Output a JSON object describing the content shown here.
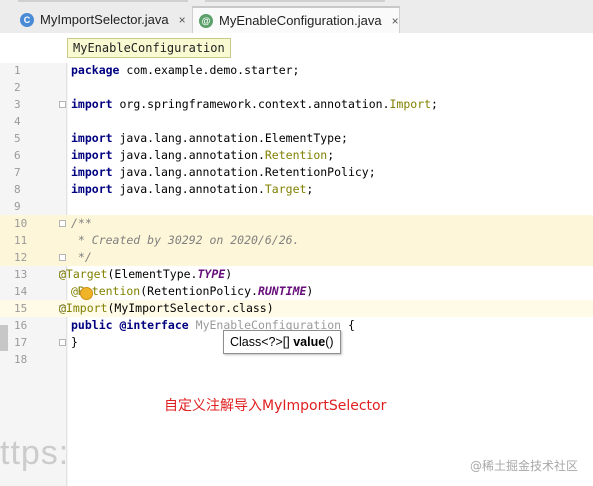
{
  "tabs": [
    {
      "icon": "class-c-icon",
      "glyph": "C",
      "label": "MyImportSelector.java",
      "close": "×"
    },
    {
      "icon": "annotation-at-icon",
      "glyph": "@",
      "label": "MyEnableConfiguration.java",
      "close": "×"
    }
  ],
  "breadcrumb": "MyEnableConfiguration",
  "lines": [
    {
      "num": "1"
    },
    {
      "num": "2"
    },
    {
      "num": "3"
    },
    {
      "num": "4"
    },
    {
      "num": "5"
    },
    {
      "num": "6"
    },
    {
      "num": "7"
    },
    {
      "num": "8"
    },
    {
      "num": "9"
    },
    {
      "num": "10"
    },
    {
      "num": "11"
    },
    {
      "num": "12"
    },
    {
      "num": "13"
    },
    {
      "num": "14"
    },
    {
      "num": "15"
    },
    {
      "num": "16"
    },
    {
      "num": "17"
    },
    {
      "num": "18"
    }
  ],
  "code": {
    "l1_kw": "package",
    "l1_rest": " com.example.demo.starter;",
    "l3_kw": "import",
    "l3_a": " org.springframework.context.annotation.",
    "l3_b": "Import",
    "l3_c": ";",
    "l5_kw": "import",
    "l5_rest": " java.lang.annotation.ElementType;",
    "l6_kw": "import",
    "l6_a": " java.lang.annotation.",
    "l6_b": "Retention",
    "l6_c": ";",
    "l7_kw": "import",
    "l7_rest": " java.lang.annotation.RetentionPolicy;",
    "l8_kw": "import",
    "l8_a": " java.lang.annotation.",
    "l8_b": "Target",
    "l8_c": ";",
    "l10": "/**",
    "l11": " * Created by 30292 on 2020/6/26.",
    "l12": " */",
    "l13_a": "@Target",
    "l13_b": "(ElementType.",
    "l13_c": "TYPE",
    "l13_d": ")",
    "l14_a": "@Retention",
    "l14_b": "(RetentionPolicy.",
    "l14_c": "RUNTIME",
    "l14_d": ")",
    "l15_a": "@Import",
    "l15_b": "(MyImportSelector.class)",
    "l16_kw": "public",
    "l16_b": " @interface ",
    "l16_c": "MyEnableConfiguration",
    "l16_d": " {",
    "l17": "}"
  },
  "tooltip": {
    "a": "Class<?>[] ",
    "b": "value",
    "c": "()"
  },
  "annotation_note": "自定义注解导入MyImportSelector",
  "watermark_left": "ttps:",
  "watermark_right": "@稀土掘金技术社区"
}
